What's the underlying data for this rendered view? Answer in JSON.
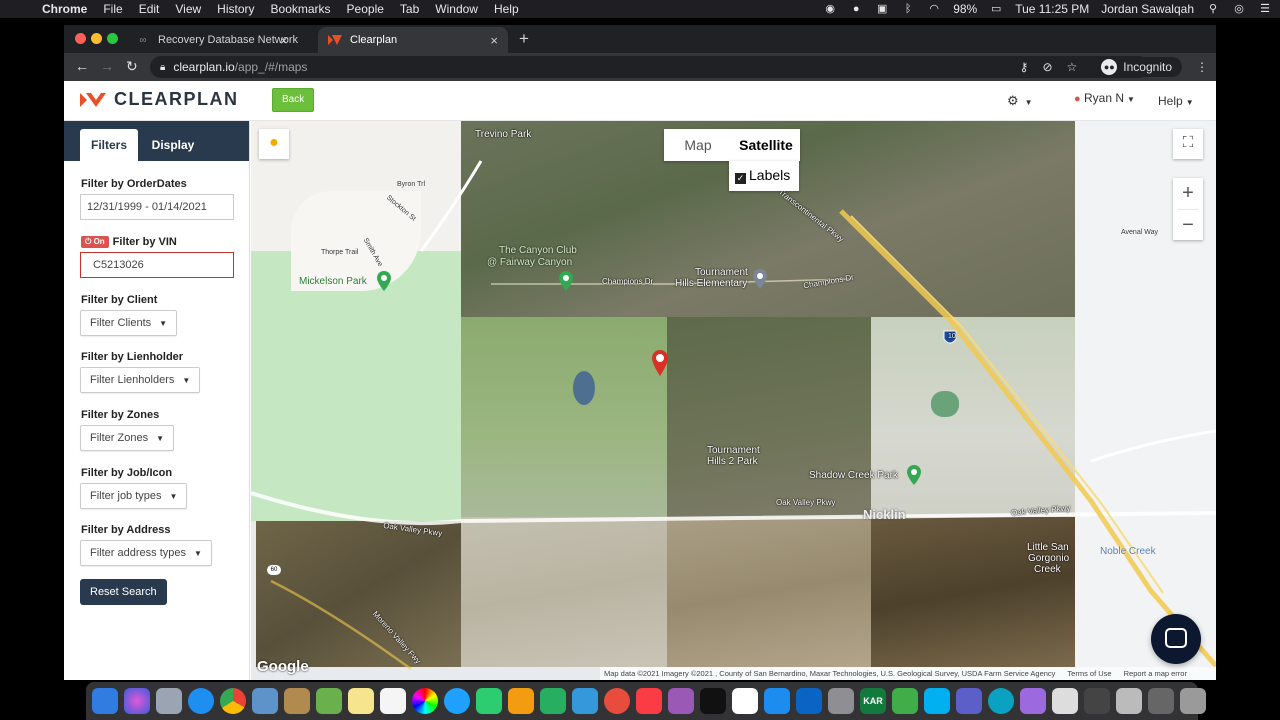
{
  "menubar": {
    "app_name": "Chrome",
    "items": [
      "File",
      "Edit",
      "View",
      "History",
      "Bookmarks",
      "People",
      "Tab",
      "Window",
      "Help"
    ],
    "battery": "98%",
    "clock": "Tue 11:25 PM",
    "user": "Jordan Sawalqah"
  },
  "browser": {
    "tabs": [
      {
        "title": "Recovery Database Network"
      },
      {
        "title": "Clearplan"
      }
    ],
    "url_host": "clearplan.io",
    "url_path": "/app_/#/maps",
    "incognito_label": "Incognito"
  },
  "app": {
    "brand": "CLEARPLAN",
    "back_label": "Back",
    "user_name": "Ryan N",
    "help_label": "Help"
  },
  "sidebar": {
    "tabs": [
      "Filters",
      "Display"
    ],
    "order_dates_label": "Filter by OrderDates",
    "order_dates_value": "12/31/1999 - 01/14/2021",
    "vin_badge": "On",
    "vin_label": "Filter by VIN",
    "vin_value": "C5213026",
    "client_label": "Filter by Client",
    "client_dropdown": "Filter Clients",
    "lienholder_label": "Filter by Lienholder",
    "lienholder_dropdown": "Filter Lienholders",
    "zones_label": "Filter by Zones",
    "zones_dropdown": "Filter Zones",
    "jobicon_label": "Filter by Job/Icon",
    "jobicon_dropdown": "Filter job types",
    "address_label": "Filter by Address",
    "address_dropdown": "Filter address types",
    "reset_label": "Reset Search"
  },
  "map": {
    "type_options": [
      "Map",
      "Satellite"
    ],
    "selected_type": "Satellite",
    "labels_label": "Labels",
    "labels_checked": true,
    "place_labels": {
      "trevino": "Trevino Park",
      "canyon_club": "The Canyon Club",
      "fairway": "@ Fairway Canyon",
      "tournament_hills": "Tournament",
      "tournament_hills_2": "Hills Elementary",
      "champions_w": "Champions Dr",
      "champions_e": "Champions Dr",
      "transcontinental": "Transcontinental Pkwy",
      "mickelson": "Mickelson Park",
      "tournament_park": "Tournament",
      "tournament_park_2": "Hills 2 Park",
      "shadow_creek": "Shadow Creek Park",
      "oak_valley_w": "Oak Valley Pkwy",
      "oak_valley_m": "Oak Valley Pkwy",
      "oak_valley_e": "Oak Valley Pkwy",
      "moreno": "Moreno Valley Fwy",
      "little_san": "Little San",
      "gorgonio": "Gorgonio",
      "creek": "Creek",
      "noble": "Noble Creek",
      "byron": "Byron Trl",
      "stockton": "Stockton St",
      "thorpe": "Thorpe Trail",
      "smith": "Smith Ave",
      "nicklin": "Nicklin",
      "avenal": "Avenal Way",
      "i10": "10",
      "r60": "60"
    },
    "google_label": "Google",
    "attribution": "Map data ©2021 Imagery ©2021 , County of San Bernardino, Maxar Technologies, U.S. Geological Survey, USDA Farm Service Agency",
    "terms": "Terms of Use",
    "report": "Report a map error"
  }
}
